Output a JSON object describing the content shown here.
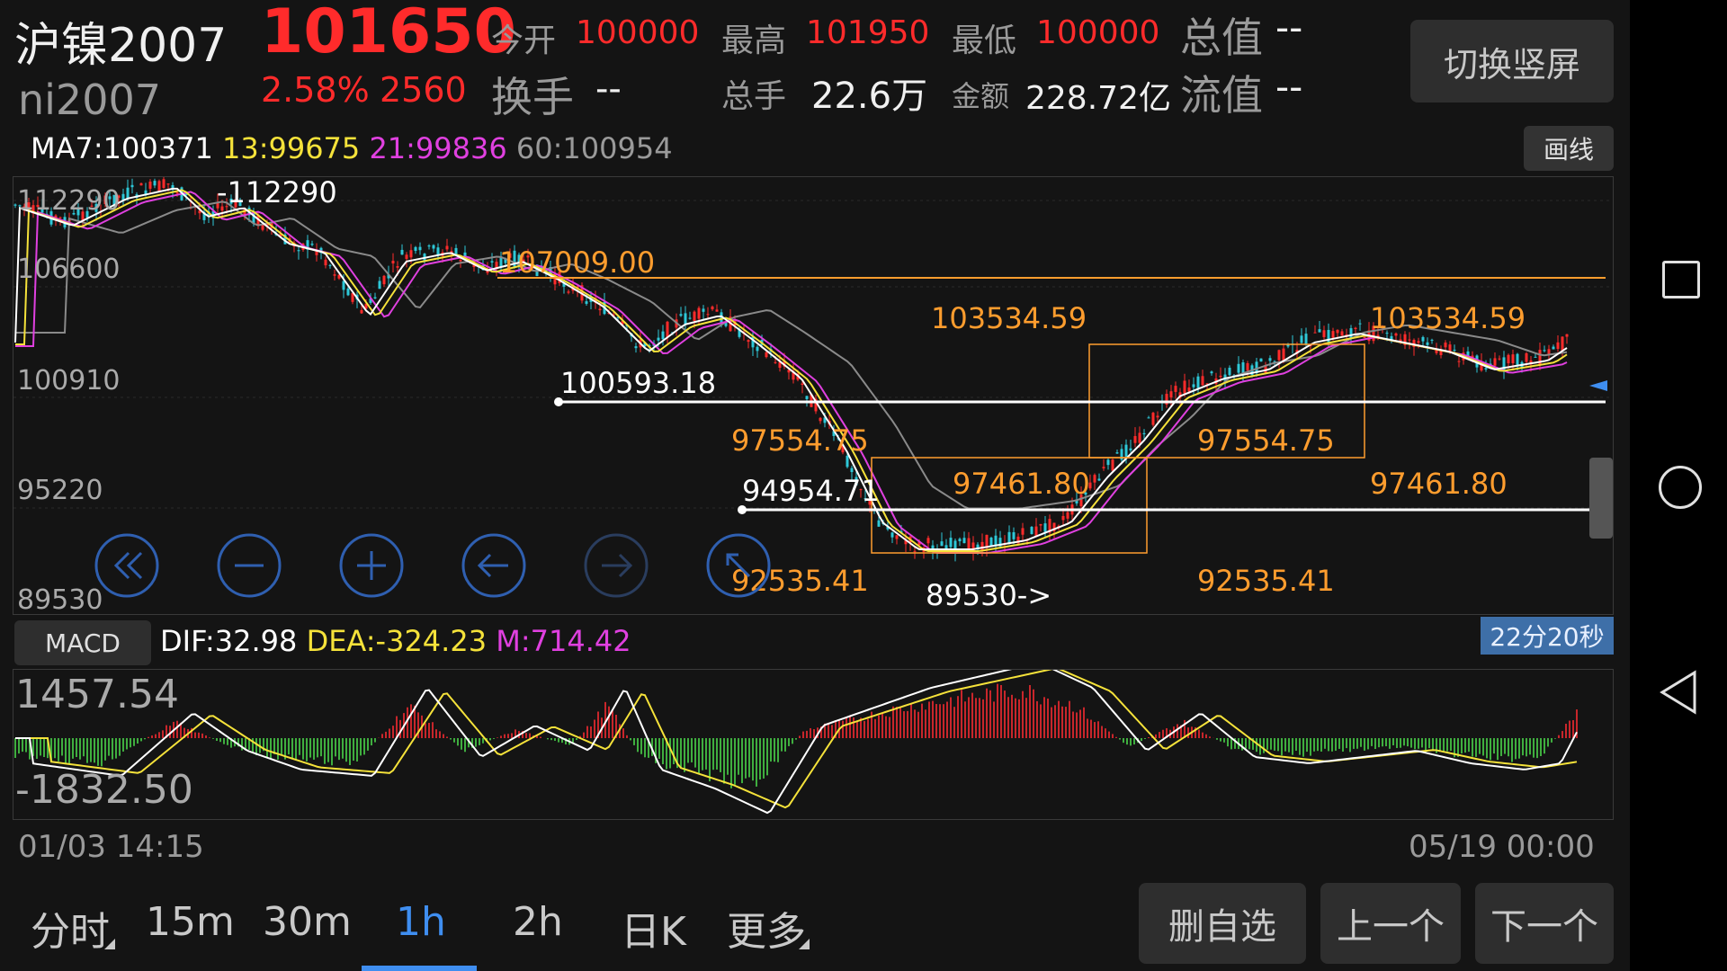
{
  "header": {
    "symbol_cn": "沪镍2007",
    "symbol_code": "ni2007",
    "last_price": "101650",
    "change_pct": "2.58%",
    "change_abs": "2560",
    "open_label": "今开",
    "open_value": "100000",
    "high_label": "最高",
    "high_value": "101950",
    "low_label": "最低",
    "low_value": "100000",
    "total_value_label": "总值",
    "total_value": "--",
    "turnover_label": "换手",
    "turnover": "--",
    "volume_label": "总手",
    "volume": "22.6万",
    "amount_label": "金额",
    "amount": "228.72亿",
    "float_value_label": "流值",
    "float_value": "--",
    "switch_button": "切换竖屏"
  },
  "ma": {
    "ma7": "MA7:100371",
    "ma13": "13:99675",
    "ma21": "21:99836",
    "ma60": "60:100954",
    "draw_button": "画线"
  },
  "price_axis": {
    "labels": [
      "112290",
      "106600",
      "100910",
      "95220",
      "89530"
    ]
  },
  "annotations": {
    "max_label": "-112290",
    "min_label": "89530->",
    "line_107009": "107009.00",
    "fib_left": [
      "103534.59",
      "97554.75",
      "97461.80",
      "92535.41"
    ],
    "fib_right": [
      "103534.59",
      "97554.75",
      "97461.80",
      "92535.41"
    ],
    "line_100593": "100593.18",
    "line_94954": "94954.71"
  },
  "colors": {
    "ma7": "#ffffff",
    "ma13": "#f5e23a",
    "ma21": "#e040e0",
    "ma60": "#9a9a9a",
    "up": "#ff2b2b",
    "down": "#2ec8d8",
    "annotation": "#ff9d2e",
    "accent": "#3f8ef0"
  },
  "macd": {
    "button": "MACD",
    "dif": "DIF:32.98",
    "dea": "DEA:-324.23",
    "m": "M:714.42",
    "timer": "22分20秒",
    "top_label": "1457.54",
    "bottom_label": "-1832.50"
  },
  "time_axis": {
    "start": "01/03 14:15",
    "end": "05/19 00:00"
  },
  "tabs": [
    "分时",
    "15m",
    "30m",
    "1h",
    "2h",
    "日K",
    "更多"
  ],
  "active_tab": "1h",
  "actions": {
    "remove_fav": "删自选",
    "prev": "上一个",
    "next": "下一个"
  },
  "chart_controls": [
    "rewind-icon",
    "zoom-out-icon",
    "zoom-in-icon",
    "pan-left-icon",
    "pan-right-icon",
    "reset-icon"
  ],
  "system_nav": [
    "recent-apps-icon",
    "home-icon",
    "back-icon"
  ]
}
